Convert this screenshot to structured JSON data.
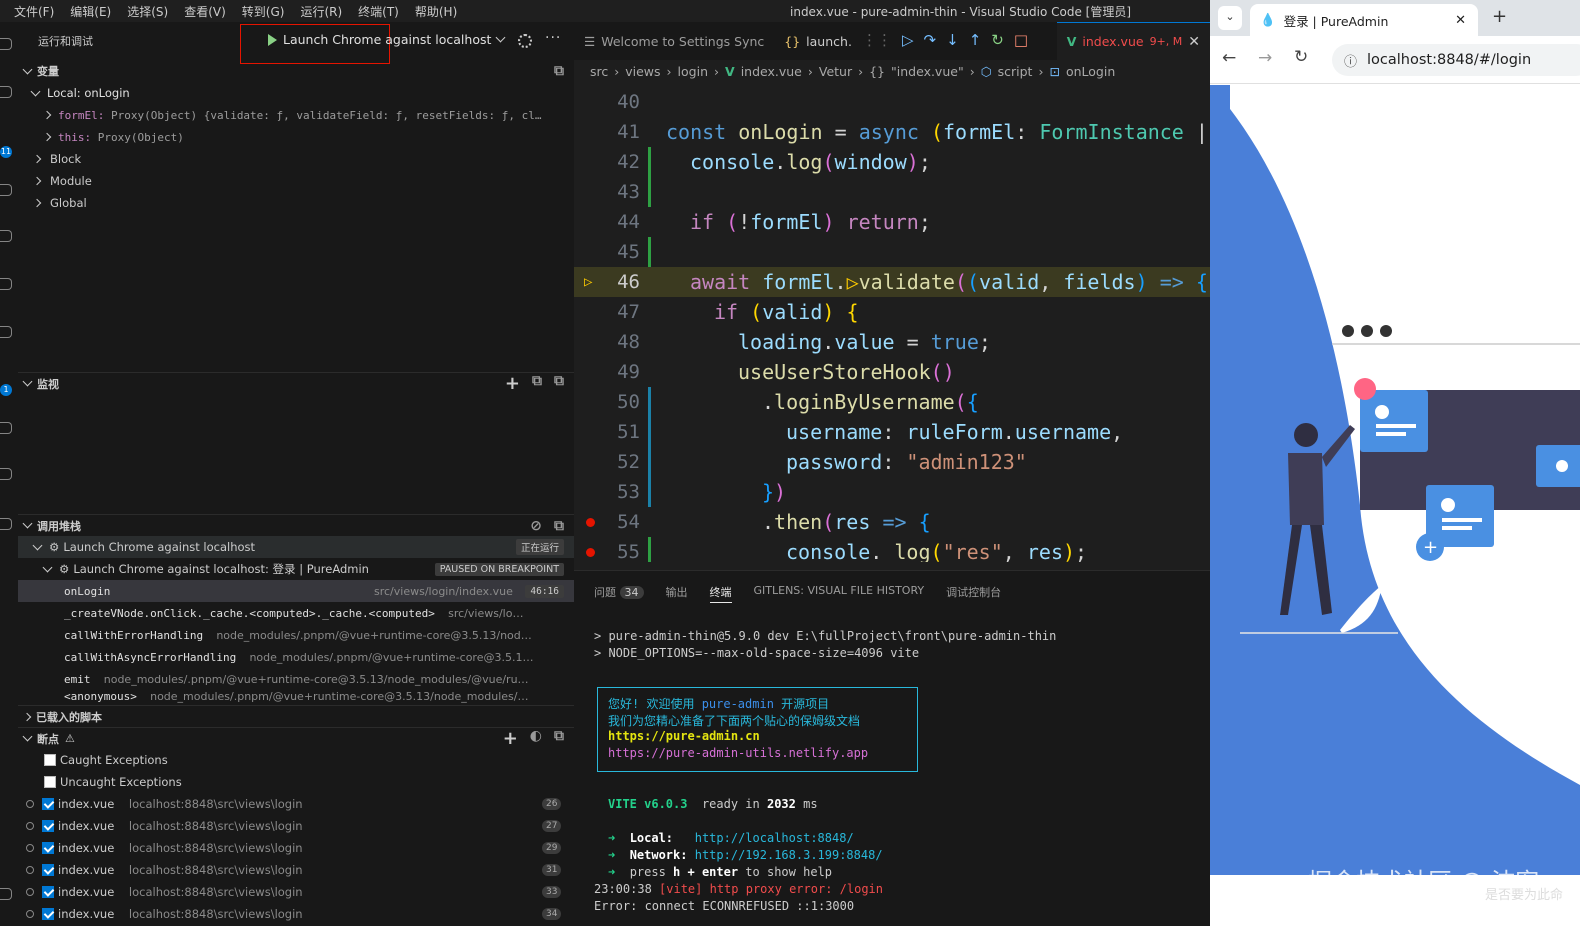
{
  "menu": [
    "文件(F)",
    "编辑(E)",
    "选择(S)",
    "查看(V)",
    "转到(G)",
    "运行(R)",
    "终端(T)",
    "帮助(H)"
  ],
  "window_title": "index.vue - pure-admin-thin - Visual Studio Code [管理员]",
  "sidebar": {
    "header": "运行和调试",
    "launch_config": "Launch Chrome against localhost",
    "variables": {
      "title": "变量",
      "local_scope": "Local: onLogin",
      "formEl_name": "formEl:",
      "formEl_value": "Proxy(Object) {validate: ƒ, validateField: ƒ, resetFields: ƒ, cl…",
      "this_name": "this:",
      "this_value": "Proxy(Object)",
      "block": "Block",
      "module": "Module",
      "global": "Global"
    },
    "watch_title": "监视",
    "callstack": {
      "title": "调用堆栈",
      "session": "Launch Chrome against localhost",
      "session_status": "正在运行",
      "target": "Launch Chrome against localhost: 登录 | PureAdmin",
      "target_status": "PAUSED ON BREAKPOINT",
      "frames": [
        {
          "name": "onLogin",
          "path": "src/views/login/index.vue",
          "badge": "46:16"
        },
        {
          "name": "_createVNode.onClick._cache.<computed>._cache.<computed>",
          "path": "src/views/lo…",
          "badge": ""
        },
        {
          "name": "callWithErrorHandling",
          "path": "node_modules/.pnpm/@vue+runtime-core@3.5.13/nod…",
          "badge": ""
        },
        {
          "name": "callWithAsyncErrorHandling",
          "path": "node_modules/.pnpm/@vue+runtime-core@3.5.1…",
          "badge": ""
        },
        {
          "name": "emit",
          "path": "node_modules/.pnpm/@vue+runtime-core@3.5.13/node_modules/@vue/ru…",
          "badge": ""
        },
        {
          "name": "<anonymous>",
          "path": "node_modules/.pnpm/@vue+runtime-core@3.5.13/node_modules/…",
          "badge": ""
        }
      ]
    },
    "loaded_scripts": "已载入的脚本",
    "breakpoints": {
      "title": "断点",
      "caught": "Caught Exceptions",
      "uncaught": "Uncaught Exceptions",
      "items": [
        {
          "file": "index.vue",
          "path": "localhost:8848\\src\\views\\login",
          "line": "26"
        },
        {
          "file": "index.vue",
          "path": "localhost:8848\\src\\views\\login",
          "line": "27"
        },
        {
          "file": "index.vue",
          "path": "localhost:8848\\src\\views\\login",
          "line": "29"
        },
        {
          "file": "index.vue",
          "path": "localhost:8848\\src\\views\\login",
          "line": "31"
        },
        {
          "file": "index.vue",
          "path": "localhost:8848\\src\\views\\login",
          "line": "33"
        },
        {
          "file": "index.vue",
          "path": "localhost:8848\\src\\views\\login",
          "line": "34"
        }
      ]
    }
  },
  "editor": {
    "tabs": [
      {
        "label": "Welcome to Settings Sync"
      },
      {
        "label": "launch."
      },
      {
        "label": "index.vue",
        "suffix": "9+, M"
      }
    ],
    "breadcrumb": [
      "src",
      "views",
      "login",
      "index.vue",
      "Vetur",
      "\"index.vue\"",
      "script",
      "onLogin"
    ],
    "line_numbers": [
      "40",
      "41",
      "42",
      "43",
      "44",
      "45",
      "46",
      "47",
      "48",
      "49",
      "50",
      "51",
      "52",
      "53",
      "54",
      "55"
    ]
  },
  "panel": {
    "tabs": [
      "问题",
      "输出",
      "终端",
      "GITLENS: VISUAL FILE HISTORY",
      "调试控制台"
    ],
    "problems_count": "34",
    "terminal": {
      "line1": "> pure-admin-thin@5.9.0 dev E:\\fullProject\\front\\pure-admin-thin",
      "line2": "> NODE_OPTIONS=--max-old-space-size=4096 vite",
      "welcome1_a": "您好! 欢迎使用 ",
      "welcome1_b": "pure-admin",
      "welcome1_c": " 开源项目",
      "welcome2": "我们为您精心准备了下面两个贴心的保姆级文档",
      "link1": "https://pure-admin.cn",
      "link2": "https://pure-admin-utils.netlify.app",
      "vite": "VITE v6.0.3",
      "ready": "ready in",
      "ready_ms": "2032",
      "ms": "ms",
      "local_label": "Local:",
      "local_url": "http://localhost:8848/",
      "network_label": "Network:",
      "network_url": "http://192.168.3.199:8848/",
      "help_a": "press ",
      "help_b": "h + enter",
      "help_c": " to show help",
      "proxy_time": "23:00:38",
      "proxy_msg": "[vite] http proxy error: /login",
      "econn": "Error: connect ECONNREFUSED ::1:3000"
    }
  },
  "browser": {
    "tab_title": "登录 | PureAdmin",
    "url": "localhost:8848/#/login"
  },
  "watermark": "掘金技术社区 @ 沫客",
  "watermark_small": "是否要为此命"
}
